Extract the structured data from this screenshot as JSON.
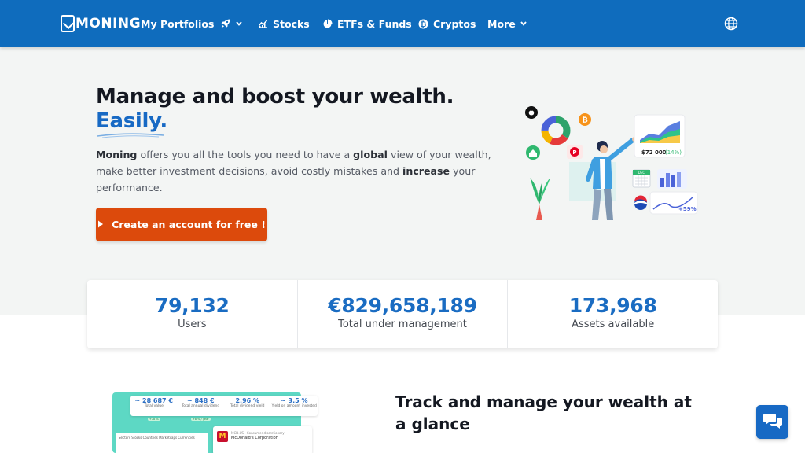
{
  "nav": {
    "logo": "MONING",
    "items": [
      {
        "label": "My Portfolios",
        "icon": ""
      },
      {
        "label": "",
        "icon": "rocket-icon"
      },
      {
        "label": "Stocks",
        "icon": "stocks-chart-icon"
      },
      {
        "label": "ETFs & Funds",
        "icon": "pie-chart-icon"
      },
      {
        "label": "Cryptos",
        "icon": "bitcoin-icon"
      },
      {
        "label": "More",
        "icon": "chevron-down-icon"
      }
    ],
    "globe_icon": "globe-icon"
  },
  "hero": {
    "title": "Manage and boost your wealth.",
    "title_accent": "Easily.",
    "lead_brand": "Moning",
    "lead_part1": " offers you all the tools you need to have a ",
    "lead_bold1": "global",
    "lead_part2": " view of your wealth, make better investment decisions, avoid costly mistakes and ",
    "lead_bold2": "increase",
    "lead_part3": " your performance.",
    "cta_label": "Create an account for free !",
    "illustration": {
      "value_label": "$72 000",
      "value_change": "(14%)",
      "calendar_label": "DEC",
      "gain_label": "+59%"
    }
  },
  "stats": [
    {
      "value": "79,132",
      "label": "Users"
    },
    {
      "value": "€829,658,189",
      "label": "Total under management"
    },
    {
      "value": "173,968",
      "label": "Assets available"
    }
  ],
  "section2": {
    "title": "Track and manage your wealth at a glance"
  },
  "mockup": {
    "cells": [
      {
        "value": "~ 28 687 €",
        "label": "Total value",
        "chip": "+78 %"
      },
      {
        "value": "~ 848 €",
        "label": "Total annual dividend",
        "chip": "+8 % / year"
      },
      {
        "value": "2.96 %",
        "label": "Total dividend yield",
        "chip": ""
      },
      {
        "value": "~ 3.5 %",
        "label": "Yield on amount invested",
        "chip": ""
      }
    ],
    "tabs": "Sectors   Stocks   Countries   Marketcaps   Currencies",
    "stock_ticker": "MCD.US · Consumer discretionary",
    "stock_name": "McDonald's Corporation"
  },
  "colors": {
    "nav": "#0f6cbd",
    "accent": "#1769c4",
    "cta": "#dc4a0c",
    "hero_bg": "#f3f5f4"
  }
}
